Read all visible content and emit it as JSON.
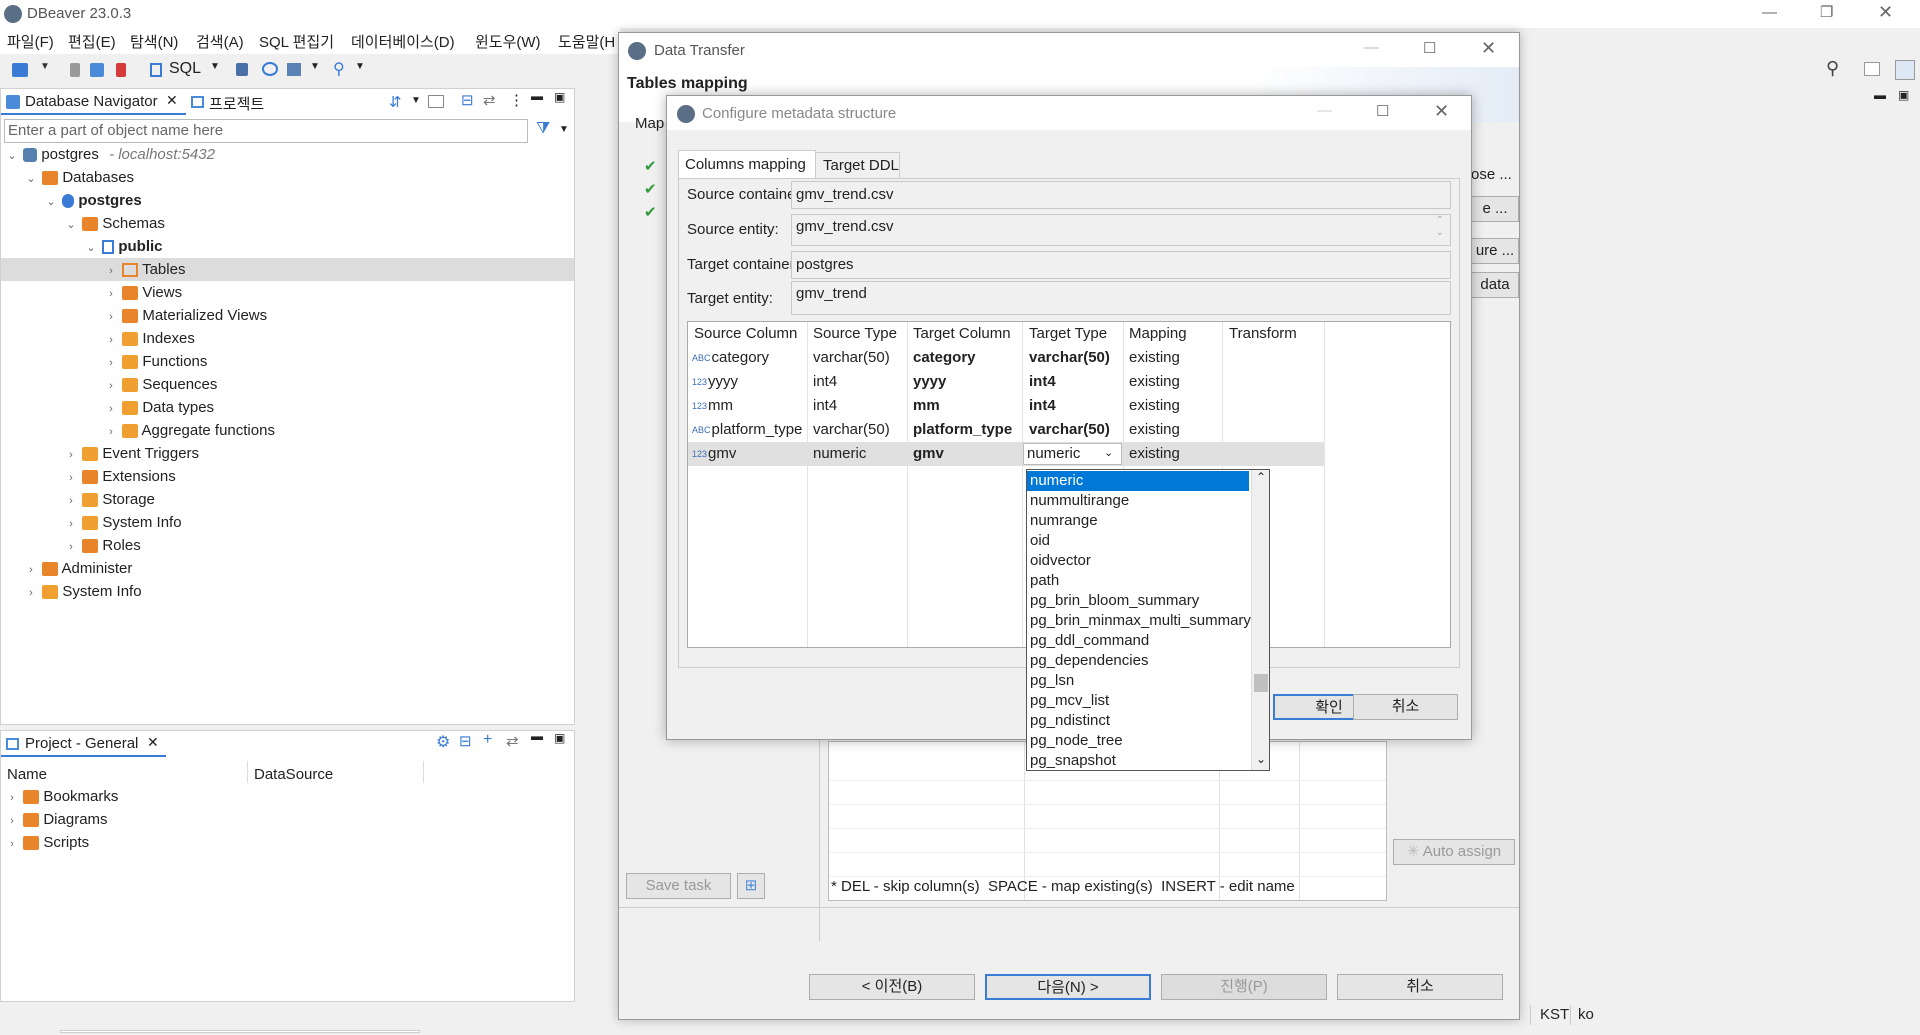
{
  "app": {
    "title": "DBeaver 23.0.3"
  },
  "menu": [
    "파일(F)",
    "편집(E)",
    "탐색(N)",
    "검색(A)",
    "SQL 편집기",
    "데이터베이스(D)",
    "윈도우(W)",
    "도움말(H"
  ],
  "toolbar": {
    "sql_label": "SQL"
  },
  "navigator": {
    "tab_label": "Database Navigator",
    "tab2_label": "프로젝트",
    "filter_placeholder": "Enter a part of object name here",
    "tree": {
      "root": "postgres",
      "root_host": "- localhost:5432",
      "databases": "Databases",
      "db": "postgres",
      "schemas": "Schemas",
      "schema": "public",
      "items": [
        "Tables",
        "Views",
        "Materialized Views",
        "Indexes",
        "Functions",
        "Sequences",
        "Data types",
        "Aggregate functions"
      ],
      "db_items": [
        "Event Triggers",
        "Extensions",
        "Storage",
        "System Info",
        "Roles"
      ],
      "root_items": [
        "Administer",
        "System Info"
      ]
    }
  },
  "project": {
    "tab_label": "Project - General",
    "col_name": "Name",
    "col_ds": "DataSource",
    "items": [
      "Bookmarks",
      "Diagrams",
      "Scripts"
    ]
  },
  "data_transfer": {
    "title": "Data Transfer",
    "heading": "Tables mapping",
    "map_label": "Map",
    "right_btns": [
      "ose ...",
      "e ...",
      "ure ...",
      "data"
    ],
    "save_task": "Save task",
    "auto_assign": "Auto assign",
    "hint": "* DEL - skip column(s)  SPACE - map existing(s)  INSERT - edit name",
    "prev": "< 이전(B)",
    "next": "다음(N) >",
    "proceed": "진행(P)",
    "cancel": "취소"
  },
  "config": {
    "title": "Configure metadata structure",
    "tabs": [
      "Columns mapping",
      "Target DDL"
    ],
    "source_container_label": "Source container:",
    "source_container": "gmv_trend.csv",
    "source_entity_label": "Source entity:",
    "source_entity": "gmv_trend.csv",
    "target_container_label": "Target container:",
    "target_container": "postgres",
    "target_entity_label": "Target entity:",
    "target_entity": "gmv_trend",
    "columns": [
      "Source Column",
      "Source Type",
      "Target Column",
      "Target Type",
      "Mapping",
      "Transform"
    ],
    "rows": [
      {
        "icon": "ABC",
        "src": "category",
        "stype": "varchar(50)",
        "tcol": "category",
        "ttype": "varchar(50)",
        "map": "existing"
      },
      {
        "icon": "123",
        "src": "yyyy",
        "stype": "int4",
        "tcol": "yyyy",
        "ttype": "int4",
        "map": "existing"
      },
      {
        "icon": "123",
        "src": "mm",
        "stype": "int4",
        "tcol": "mm",
        "ttype": "int4",
        "map": "existing"
      },
      {
        "icon": "ABC",
        "src": "platform_type",
        "stype": "varchar(50)",
        "tcol": "platform_type",
        "ttype": "varchar(50)",
        "map": "existing"
      },
      {
        "icon": "123",
        "src": "gmv",
        "stype": "numeric",
        "tcol": "gmv",
        "ttype": "numeric",
        "map": "existing"
      }
    ],
    "ok": "확인",
    "cancel": "취소",
    "dropdown": [
      "numeric",
      "nummultirange",
      "numrange",
      "oid",
      "oidvector",
      "path",
      "pg_brin_bloom_summary",
      "pg_brin_minmax_multi_summary",
      "pg_ddl_command",
      "pg_dependencies",
      "pg_lsn",
      "pg_mcv_list",
      "pg_ndistinct",
      "pg_node_tree",
      "pg_snapshot"
    ]
  },
  "status": {
    "tz": "KST",
    "locale": "ko"
  }
}
